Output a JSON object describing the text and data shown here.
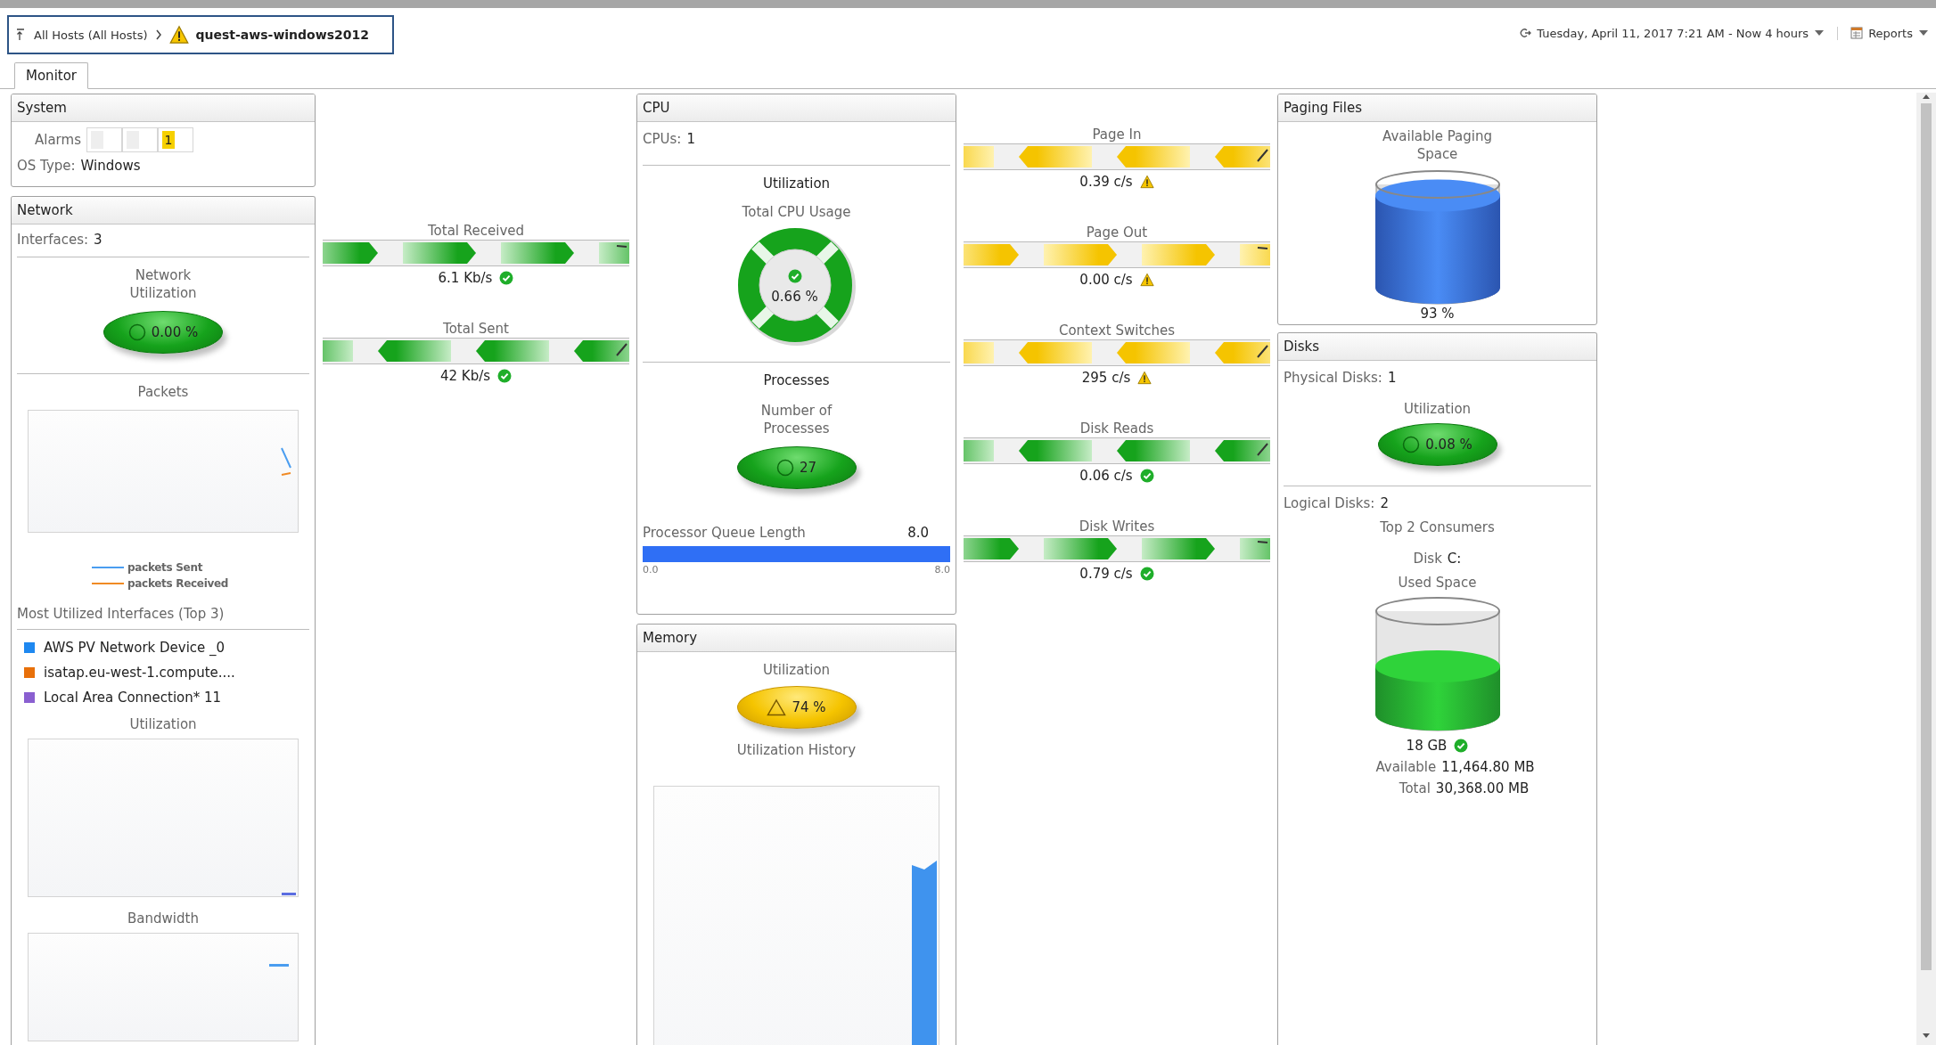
{
  "breadcrumb": {
    "root": "All Hosts (All Hosts)",
    "current": "quest-aws-windows2012",
    "warning": true
  },
  "time_range": "Tuesday, April 11, 2017 7:21 AM - Now 4 hours",
  "reports": "Reports",
  "tabs": [
    {
      "label": "Monitor",
      "selected": true
    }
  ],
  "system": {
    "title": "System",
    "alarms_label": "Alarms",
    "alarms": [
      {
        "active": false
      },
      {
        "active": false
      },
      {
        "active": true,
        "count": "1"
      }
    ],
    "os_label": "OS Type:",
    "os_value": "Windows"
  },
  "network": {
    "title": "Network",
    "interfaces_label": "Interfaces:",
    "interfaces_value": "3",
    "utilization": {
      "title": "Network Utilization",
      "value": "0.00 %",
      "warning": false
    },
    "packets": {
      "title": "Packets",
      "legend": [
        {
          "name": "packets Sent",
          "color": "#4a9df0"
        },
        {
          "name": "packets Received",
          "color": "#f08a24"
        }
      ]
    },
    "top_title": "Most Utilized Interfaces (Top 3)",
    "interfaces": [
      {
        "name": "AWS PV Network Device _0",
        "color": "#1e88f0"
      },
      {
        "name": "isatap.eu-west-1.compute....",
        "color": "#e8700a"
      },
      {
        "name": "Local Area Connection* 11",
        "color": "#8a5fd0"
      }
    ],
    "utilization_chart": "Utilization",
    "bandwidth_chart": "Bandwidth"
  },
  "flows_left": [
    {
      "label": "Total Received",
      "value": "6.1 Kb/s",
      "warning": false,
      "points_left": false
    },
    {
      "label": "Total Sent",
      "value": "42 Kb/s",
      "warning": false,
      "points_left": true
    }
  ],
  "cpu": {
    "title": "CPU",
    "cpus_label": "CPUs:",
    "cpus_value": "1",
    "utilization_title": "Utilization",
    "usage_title": "Total CPU Usage",
    "usage_value": "0.66 %",
    "usage_warning": false,
    "processes_title": "Processes",
    "processes_label": "Number of Processes",
    "processes_value": "27",
    "processes_warning": false,
    "queue": {
      "label": "Processor Queue Length",
      "value": "8.0",
      "level": 1,
      "min": "0.0",
      "max": "8.0"
    }
  },
  "memory": {
    "title": "Memory",
    "utilization_title": "Utilization",
    "value": "74 %",
    "warning": true,
    "history_title": "Utilization History"
  },
  "flows_right": [
    {
      "label": "Page In",
      "value": "0.39 c/s",
      "warning": true,
      "points_left": true
    },
    {
      "label": "Page Out",
      "value": "0.00 c/s",
      "warning": true,
      "points_left": false
    },
    {
      "label": "Context Switches",
      "value": "295 c/s",
      "warning": true,
      "points_left": true
    },
    {
      "label": "Disk Reads",
      "value": "0.06 c/s",
      "warning": false,
      "points_left": true
    },
    {
      "label": "Disk Writes",
      "value": "0.79 c/s",
      "warning": false,
      "points_left": false
    }
  ],
  "paging": {
    "title": "Paging Files",
    "label": "Available Paging Space",
    "level": 0.93,
    "value": "93 %"
  },
  "disks": {
    "title": "Disks",
    "physical_label": "Physical Disks:",
    "physical_value": "1",
    "utilization_title": "Utilization",
    "utilization_value": "0.08 %",
    "utilization_warning": false,
    "logical_label": "Logical Disks:",
    "logical_value": "2",
    "consumers_title": "Top 2 Consumers",
    "disk_label": "Disk",
    "disk_name": "C:",
    "used_title": "Used Space",
    "level": 0.6,
    "used_value": "18 GB",
    "used_warning": false,
    "available_label": "Available",
    "available_value": "11,464.80 MB",
    "total_label": "Total",
    "total_value": "30,368.00 MB"
  }
}
